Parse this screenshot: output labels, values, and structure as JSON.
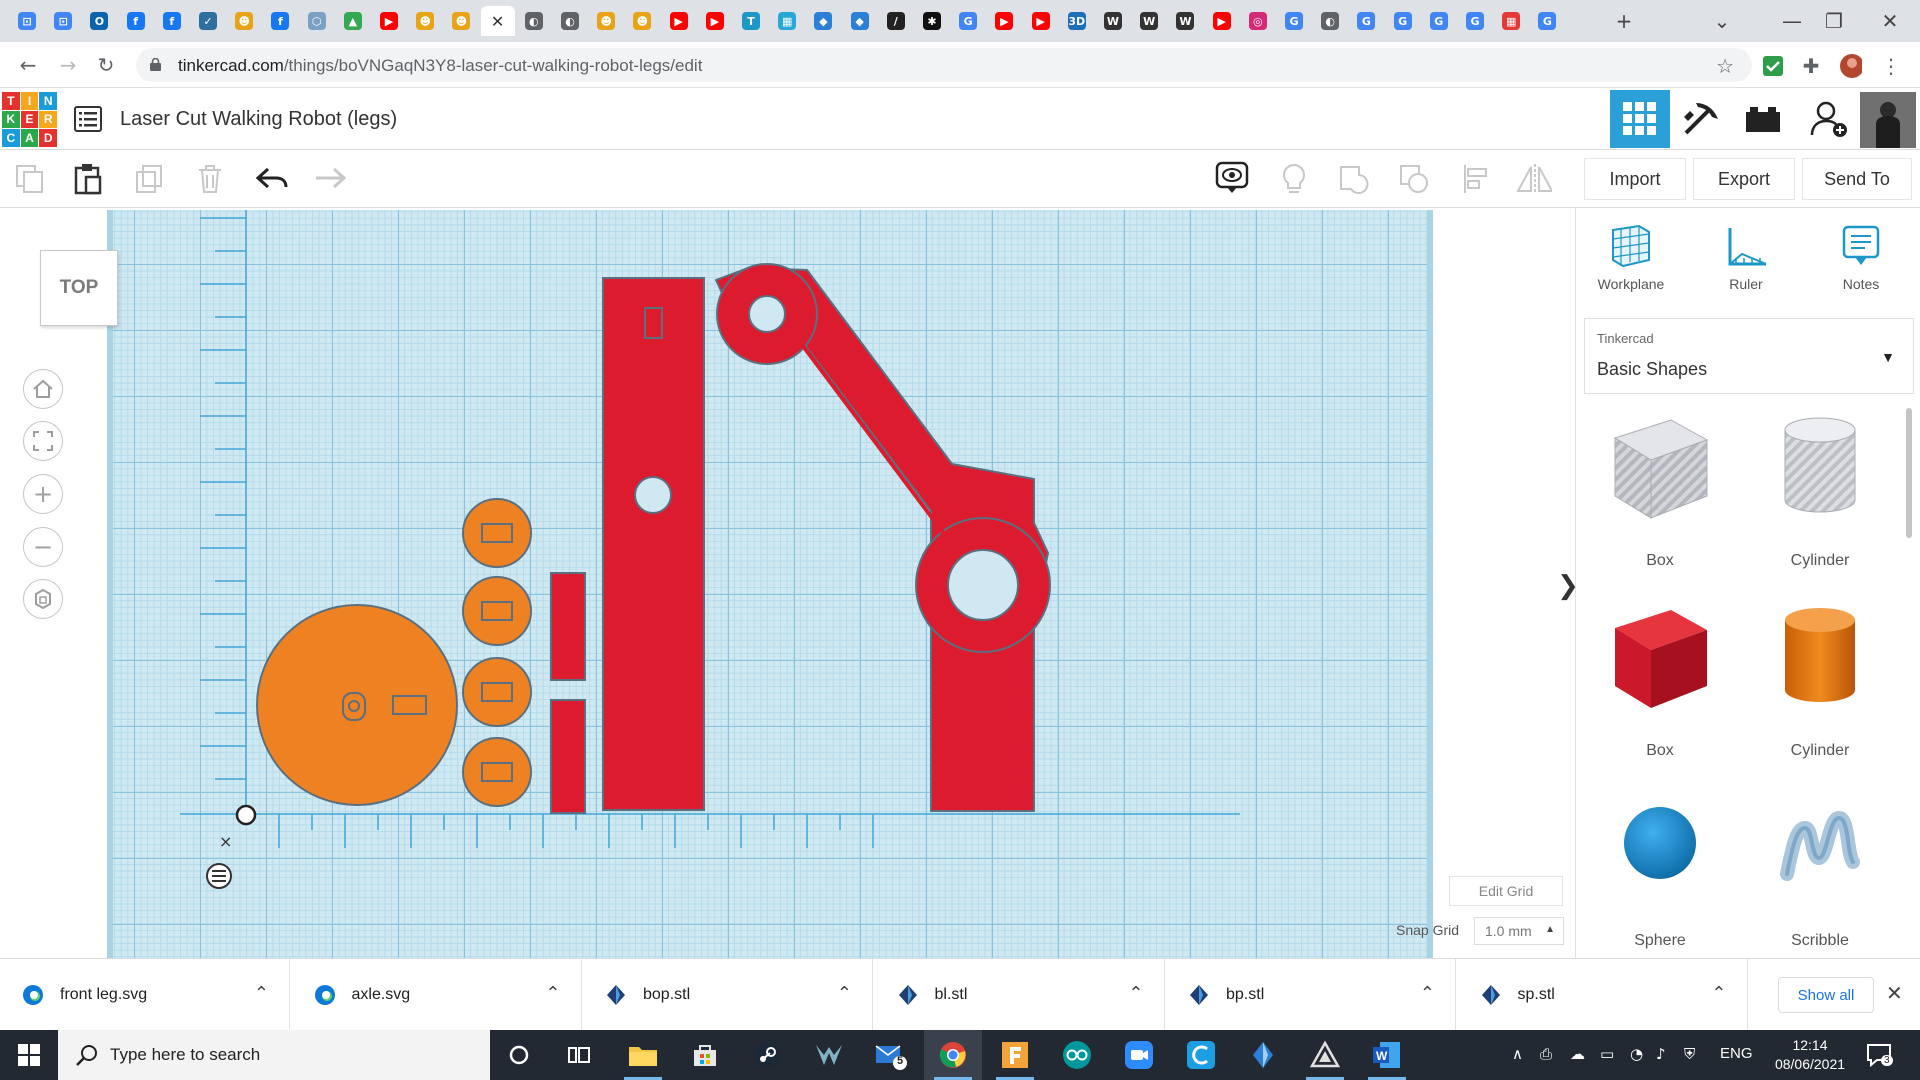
{
  "browser": {
    "tabs": [
      {
        "icon": "google-drive-icon",
        "color": "#4285f4",
        "glyph": "⊡"
      },
      {
        "icon": "google-drive-icon",
        "color": "#4285f4",
        "glyph": "⊡"
      },
      {
        "icon": "outlook-icon",
        "color": "#0a64ad",
        "glyph": "O"
      },
      {
        "icon": "facebook-icon",
        "color": "#1877f2",
        "glyph": "f"
      },
      {
        "icon": "facebook-icon",
        "color": "#1877f2",
        "glyph": "f"
      },
      {
        "icon": "bird-icon",
        "color": "#2f6f9f",
        "glyph": "✓"
      },
      {
        "icon": "chat-face-icon",
        "color": "#e8a317",
        "glyph": "☻"
      },
      {
        "icon": "facebook-icon",
        "color": "#1877f2",
        "glyph": "f"
      },
      {
        "icon": "settings-hex-icon",
        "color": "#7aa0c4",
        "glyph": "⬡"
      },
      {
        "icon": "drive-triangle-icon",
        "color": "#34a853",
        "glyph": "▲"
      },
      {
        "icon": "youtube-icon",
        "color": "#ff0000",
        "glyph": "▶"
      },
      {
        "icon": "chat-face-icon",
        "color": "#e8a317",
        "glyph": "☻"
      },
      {
        "icon": "chat-face-icon",
        "color": "#e8a317",
        "glyph": "☻"
      },
      {
        "icon": "globe-icon",
        "color": "#5f6368",
        "glyph": "◐"
      },
      {
        "icon": "globe-icon",
        "color": "#5f6368",
        "glyph": "◐"
      },
      {
        "icon": "chat-face-icon",
        "color": "#e8a317",
        "glyph": "☻"
      },
      {
        "icon": "chat-face-icon",
        "color": "#e8a317",
        "glyph": "☻"
      },
      {
        "icon": "youtube-icon",
        "color": "#ff0000",
        "glyph": "▶"
      },
      {
        "icon": "youtube-icon",
        "color": "#ff0000",
        "glyph": "▶"
      },
      {
        "icon": "tinkercad-t-icon",
        "color": "#1d97c8",
        "glyph": "T"
      },
      {
        "icon": "tinkercad-blocks-icon",
        "color": "#28a8d6",
        "glyph": "▦"
      },
      {
        "icon": "tinkercad-learn-icon",
        "color": "#2b7fd6",
        "glyph": "◆"
      },
      {
        "icon": "tinkercad-learn-icon",
        "color": "#2b7fd6",
        "glyph": "◆"
      },
      {
        "icon": "pen-icon",
        "color": "#222222",
        "glyph": "/"
      },
      {
        "icon": "paw-icon",
        "color": "#111111",
        "glyph": "✱"
      },
      {
        "icon": "google-icon",
        "color": "#4285f4",
        "glyph": "G"
      },
      {
        "icon": "youtube-icon",
        "color": "#ff0000",
        "glyph": "▶"
      },
      {
        "icon": "youtube-icon",
        "color": "#ff0000",
        "glyph": "▶"
      },
      {
        "icon": "3d-icon",
        "color": "#1e6fb8",
        "glyph": "3D"
      },
      {
        "icon": "wikipedia-icon",
        "color": "#333333",
        "glyph": "W"
      },
      {
        "icon": "wikipedia-icon",
        "color": "#333333",
        "glyph": "W"
      },
      {
        "icon": "wikipedia-icon",
        "color": "#333333",
        "glyph": "W"
      },
      {
        "icon": "youtube-icon",
        "color": "#ff0000",
        "glyph": "▶"
      },
      {
        "icon": "instagram-icon",
        "color": "#d62976",
        "glyph": "◎"
      },
      {
        "icon": "google-icon",
        "color": "#4285f4",
        "glyph": "G"
      },
      {
        "icon": "globe-icon",
        "color": "#5f6368",
        "glyph": "◐"
      },
      {
        "icon": "google-icon",
        "color": "#4285f4",
        "glyph": "G"
      },
      {
        "icon": "google-icon",
        "color": "#4285f4",
        "glyph": "G"
      },
      {
        "icon": "google-icon",
        "color": "#4285f4",
        "glyph": "G"
      },
      {
        "icon": "google-icon",
        "color": "#4285f4",
        "glyph": "G"
      },
      {
        "icon": "grid-app-icon",
        "color": "#e53935",
        "glyph": "▦"
      },
      {
        "icon": "google-icon",
        "color": "#4285f4",
        "glyph": "G"
      }
    ],
    "url_host": "tinkercad.com",
    "url_path": "/things/boVNGaqN3Y8-laser-cut-walking-robot-legs/edit"
  },
  "app": {
    "logo_letters": [
      "T",
      "I",
      "N",
      "K",
      "E",
      "R",
      "C",
      "A",
      "D"
    ],
    "design_title": "Laser Cut Walking Robot (legs)",
    "actions": {
      "import": "Import",
      "export": "Export",
      "send_to": "Send To"
    },
    "view_cube_label": "TOP",
    "edit_grid_label": "Edit Grid",
    "snap_grid_label": "Snap Grid",
    "snap_grid_value": "1.0 mm"
  },
  "panel": {
    "tools": [
      {
        "label": "Workplane",
        "icon": "workplane-icon"
      },
      {
        "label": "Ruler",
        "icon": "ruler-icon"
      },
      {
        "label": "Notes",
        "icon": "notes-icon"
      }
    ],
    "library_source": "Tinkercad",
    "library_name": "Basic Shapes",
    "shapes": [
      {
        "label": "Box",
        "kind": "box-hole",
        "color": "#b9bcc2"
      },
      {
        "label": "Cylinder",
        "kind": "cylinder-hole",
        "color": "#c7cad0"
      },
      {
        "label": "Box",
        "kind": "box",
        "color": "#d0202e"
      },
      {
        "label": "Cylinder",
        "kind": "cylinder",
        "color": "#e8780f"
      },
      {
        "label": "Sphere",
        "kind": "sphere",
        "color": "#1c8fcf"
      },
      {
        "label": "Scribble",
        "kind": "scribble",
        "color": "#8fb7d6"
      }
    ]
  },
  "colors": {
    "part_red": "#dc1c2e",
    "part_orange": "#ee8222",
    "tinkercad_blue": "#1d97c8",
    "logo_cells": [
      "#e5322d",
      "#f8a61c",
      "#1b9bd7",
      "#2ba84a",
      "#e5322d",
      "#f8a61c",
      "#1b9bd7",
      "#2ba84a",
      "#e5322d"
    ]
  },
  "downloads": [
    {
      "name": "front leg.svg",
      "icon": "edge-icon"
    },
    {
      "name": "axle.svg",
      "icon": "edge-icon"
    },
    {
      "name": "bop.stl",
      "icon": "stl-file-icon"
    },
    {
      "name": "bl.stl",
      "icon": "stl-file-icon"
    },
    {
      "name": "bp.stl",
      "icon": "stl-file-icon"
    },
    {
      "name": "sp.stl",
      "icon": "stl-file-icon"
    }
  ],
  "downloads_show_all": "Show all",
  "taskbar": {
    "search_placeholder": "Type here to search",
    "mail_badge": "5",
    "language": "ENG",
    "time": "12:14",
    "date": "08/06/2021",
    "notification_count": "3"
  }
}
